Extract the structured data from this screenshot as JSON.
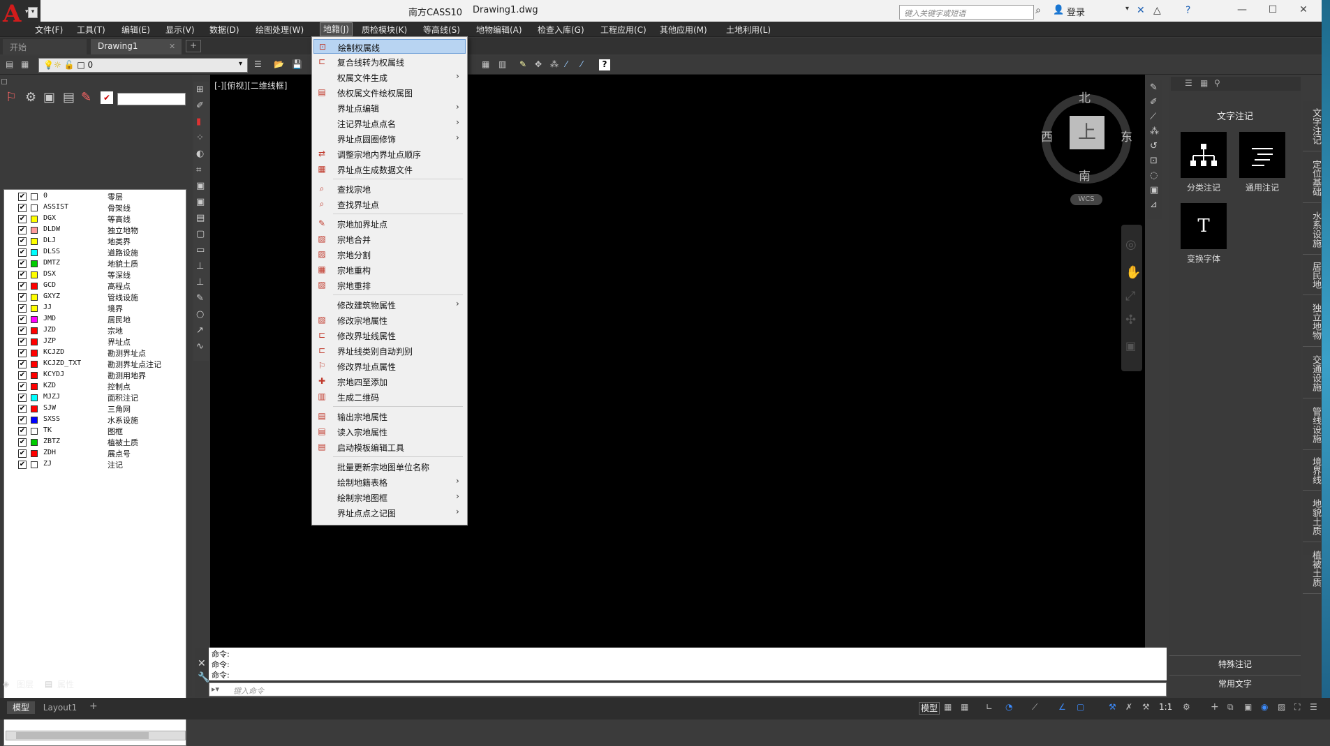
{
  "window": {
    "app_title": "南方CASS10",
    "doc_title": "Drawing1.dwg",
    "search_placeholder": "键入关键字或短语",
    "login": "登录",
    "icons": [
      "binoculars-icon",
      "user-icon",
      "x-exchange-icon",
      "a360-icon",
      "help-icon"
    ]
  },
  "menubar": [
    "文件(F)",
    "工具(T)",
    "编辑(E)",
    "显示(V)",
    "数据(D)",
    "绘图处理(W)",
    "地籍(J)",
    "质检模块(K)",
    "等高线(S)",
    "地物编辑(A)",
    "检查入库(G)",
    "工程应用(C)",
    "其他应用(M)",
    "土地利用(L)"
  ],
  "tabs": {
    "start": "开始",
    "drawing": "Drawing1",
    "plus": "+"
  },
  "layer_toolbar": {
    "current_layer": "0"
  },
  "layers": [
    {
      "name": "0",
      "desc": "零层",
      "color": "#ffffff"
    },
    {
      "name": "ASSIST",
      "desc": "骨架线",
      "color": "#ffffff"
    },
    {
      "name": "DGX",
      "desc": "等高线",
      "color": "#ffff00"
    },
    {
      "name": "DLDW",
      "desc": "独立地物",
      "color": "#ff9c9c"
    },
    {
      "name": "DLJ",
      "desc": "地类界",
      "color": "#ffff00"
    },
    {
      "name": "DLSS",
      "desc": "道路设施",
      "color": "#00ffff"
    },
    {
      "name": "DMTZ",
      "desc": "地貌土质",
      "color": "#00cc00"
    },
    {
      "name": "DSX",
      "desc": "等深线",
      "color": "#ffff00"
    },
    {
      "name": "GCD",
      "desc": "高程点",
      "color": "#ff0000"
    },
    {
      "name": "GXYZ",
      "desc": "管线设施",
      "color": "#ffff00"
    },
    {
      "name": "JJ",
      "desc": "境界",
      "color": "#ffff00"
    },
    {
      "name": "JMD",
      "desc": "居民地",
      "color": "#ff00ff"
    },
    {
      "name": "JZD",
      "desc": "宗地",
      "color": "#ff0000"
    },
    {
      "name": "JZP",
      "desc": "界址点",
      "color": "#ff0000"
    },
    {
      "name": "KCJZD",
      "desc": "勘测界址点",
      "color": "#ff0000"
    },
    {
      "name": "KCJZD_TXT",
      "desc": "勘测界址点注记",
      "color": "#ff0000"
    },
    {
      "name": "KCYDJ",
      "desc": "勘测用地界",
      "color": "#ff0000"
    },
    {
      "name": "KZD",
      "desc": "控制点",
      "color": "#ff0000"
    },
    {
      "name": "MJZJ",
      "desc": "面积注记",
      "color": "#00ffff"
    },
    {
      "name": "SJW",
      "desc": "三角网",
      "color": "#ff0000"
    },
    {
      "name": "SXSS",
      "desc": "水系设施",
      "color": "#0000ff"
    },
    {
      "name": "TK",
      "desc": "图框",
      "color": "#ffffff"
    },
    {
      "name": "ZBTZ",
      "desc": "植被土质",
      "color": "#00cc00"
    },
    {
      "name": "ZDH",
      "desc": "展点号",
      "color": "#ff0000"
    },
    {
      "name": "ZJ",
      "desc": "注记",
      "color": "#ffffff"
    }
  ],
  "left_tabs": {
    "layers": "图层",
    "props": "属性"
  },
  "viewport_label": "[-][俯视][二维线框]",
  "viewcube": {
    "north": "北",
    "south": "南",
    "east": "东",
    "west": "西",
    "face": "上",
    "wcs": "WCS"
  },
  "dropdown": [
    {
      "label": "绘制权属线",
      "icon": "draw-boundary-icon",
      "arrow": false,
      "highlight": true
    },
    {
      "label": "复合线转为权属线",
      "icon": "convert-polyline-icon",
      "arrow": false
    },
    {
      "label": "权属文件生成",
      "icon": "",
      "arrow": true
    },
    {
      "label": "依权属文件绘权属图",
      "icon": "file-draw-icon",
      "arrow": false
    },
    {
      "label": "界址点编辑",
      "icon": "",
      "arrow": true
    },
    {
      "label": "注记界址点点名",
      "icon": "",
      "arrow": true
    },
    {
      "label": "界址点圆圈修饰",
      "icon": "",
      "arrow": true
    },
    {
      "label": "调整宗地内界址点顺序",
      "icon": "reorder-icon",
      "arrow": false
    },
    {
      "label": "界址点生成数据文件",
      "icon": "dat-file-icon",
      "arrow": false
    },
    {
      "sep": true
    },
    {
      "label": "查找宗地",
      "icon": "find-parcel-icon",
      "arrow": false
    },
    {
      "label": "查找界址点",
      "icon": "find-point-icon",
      "arrow": false
    },
    {
      "sep": true
    },
    {
      "label": "宗地加界址点",
      "icon": "add-point-icon",
      "arrow": false
    },
    {
      "label": "宗地合并",
      "icon": "merge-icon",
      "arrow": false
    },
    {
      "label": "宗地分割",
      "icon": "split-icon",
      "arrow": false
    },
    {
      "label": "宗地重构",
      "icon": "rebuild-icon",
      "arrow": false
    },
    {
      "label": "宗地重排",
      "icon": "rearrange-icon",
      "arrow": false
    },
    {
      "sep": true
    },
    {
      "label": "修改建筑物属性",
      "icon": "",
      "arrow": true
    },
    {
      "label": "修改宗地属性",
      "icon": "edit-parcel-icon",
      "arrow": false
    },
    {
      "label": "修改界址线属性",
      "icon": "edit-line-icon",
      "arrow": false
    },
    {
      "label": "界址线类别自动判别",
      "icon": "auto-classify-icon",
      "arrow": false
    },
    {
      "label": "修改界址点属性",
      "icon": "edit-point-icon",
      "arrow": false
    },
    {
      "label": "宗地四至添加",
      "icon": "boundary-add-icon",
      "arrow": false
    },
    {
      "label": "生成二维码",
      "icon": "qrcode-icon",
      "arrow": false
    },
    {
      "sep": true
    },
    {
      "label": "输出宗地属性",
      "icon": "export-mdb-icon",
      "arrow": false
    },
    {
      "label": "读入宗地属性",
      "icon": "import-mdb-icon",
      "arrow": false
    },
    {
      "label": "启动模板编辑工具",
      "icon": "template-icon",
      "arrow": false
    },
    {
      "sep": true
    },
    {
      "label": "批量更新宗地图单位名称",
      "icon": "",
      "arrow": false
    },
    {
      "label": "绘制地籍表格",
      "icon": "",
      "arrow": true
    },
    {
      "label": "绘制宗地图框",
      "icon": "",
      "arrow": true
    },
    {
      "label": "界址点点之记图",
      "icon": "",
      "arrow": true
    }
  ],
  "right_panel": {
    "title": "文字注记",
    "buttons": [
      {
        "label": "分类注记",
        "icon": "tree-icon"
      },
      {
        "label": "通用注记",
        "icon": "text-lines-icon"
      },
      {
        "label": "变换字体",
        "icon": "font-T-icon"
      }
    ],
    "bottom1": "特殊注记",
    "bottom2": "常用文字",
    "side_tabs": [
      "文字注记",
      "定位基础",
      "水系设施",
      "居民地",
      "独立地物",
      "交通设施",
      "管线设施",
      "境界线",
      "地貌土质",
      "植被土质"
    ]
  },
  "command": {
    "history": [
      "命令:",
      "命令:",
      "命令:"
    ],
    "placeholder": "键入命令"
  },
  "status": {
    "model_tab": "模型",
    "layout_tab": "Layout1",
    "model_label": "模型",
    "scale": "1:1"
  }
}
